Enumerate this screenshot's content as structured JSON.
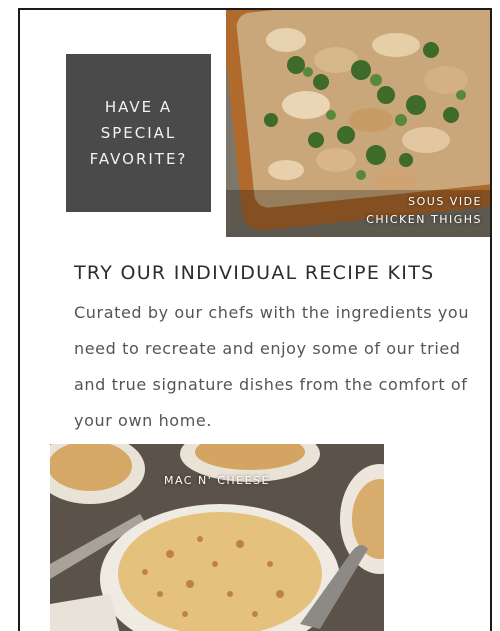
{
  "promo": {
    "text": "HAVE A SPECIAL FAVORITE?"
  },
  "hero": {
    "label_line1": "SOUS VIDE",
    "label_line2": "CHICKEN THIGHS"
  },
  "section": {
    "headline": "TRY OUR INDIVIDUAL RECIPE KITS",
    "body": "Curated by our chefs with the ingredients you need to recreate and enjoy some of our tried and true signature dishes from the comfort of your own home."
  },
  "feature": {
    "label": "MAC N' CHEESE"
  },
  "colors": {
    "promo_bg": "#4a4a4a",
    "headline": "#2d2d2d",
    "body": "#555555"
  }
}
